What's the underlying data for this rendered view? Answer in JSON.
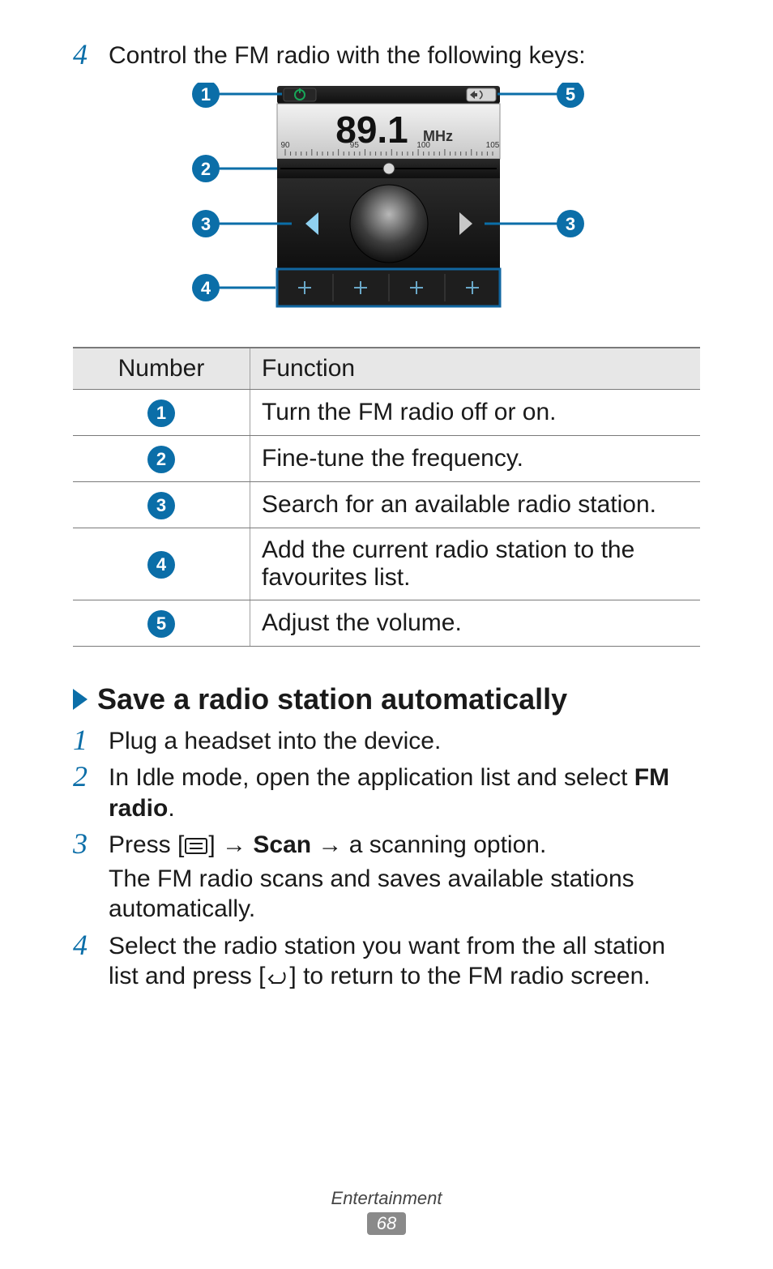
{
  "intro_step": {
    "num": "4",
    "text": "Control the FM radio with the following keys:"
  },
  "radio": {
    "frequency": "89.1",
    "unit": "MHz",
    "ticks": {
      "labels": [
        "90",
        "95",
        "100",
        "105"
      ]
    }
  },
  "table": {
    "headers": {
      "number": "Number",
      "function": "Function"
    },
    "rows": [
      {
        "badge": "1",
        "function": "Turn the FM radio off or on."
      },
      {
        "badge": "2",
        "function": "Fine-tune the frequency."
      },
      {
        "badge": "3",
        "function": "Search for an available radio station."
      },
      {
        "badge": "4",
        "function": "Add the current radio station to the favourites list."
      },
      {
        "badge": "5",
        "function": "Adjust the volume."
      }
    ]
  },
  "section": {
    "title": "Save a radio station automatically"
  },
  "steps": [
    {
      "num": "1",
      "parts": [
        "Plug a headset into the device."
      ]
    },
    {
      "num": "2",
      "parts": [
        "In Idle mode, open the application list and select ",
        {
          "b": "FM radio"
        },
        "."
      ]
    },
    {
      "num": "3",
      "parts": [
        "Press [",
        {
          "icon": "menu"
        },
        "] → ",
        {
          "b": "Scan"
        },
        " → a scanning option."
      ],
      "extra": "The FM radio scans and saves available stations automatically."
    },
    {
      "num": "4",
      "parts": [
        "Select the radio station you want from the all station list and press [",
        {
          "icon": "back"
        },
        "] to return to the FM radio screen."
      ]
    }
  ],
  "footer": {
    "category": "Entertainment",
    "page": "68"
  },
  "callouts": [
    "1",
    "2",
    "3",
    "3",
    "4",
    "5"
  ],
  "colors": {
    "accent": "#0b6ea8"
  }
}
